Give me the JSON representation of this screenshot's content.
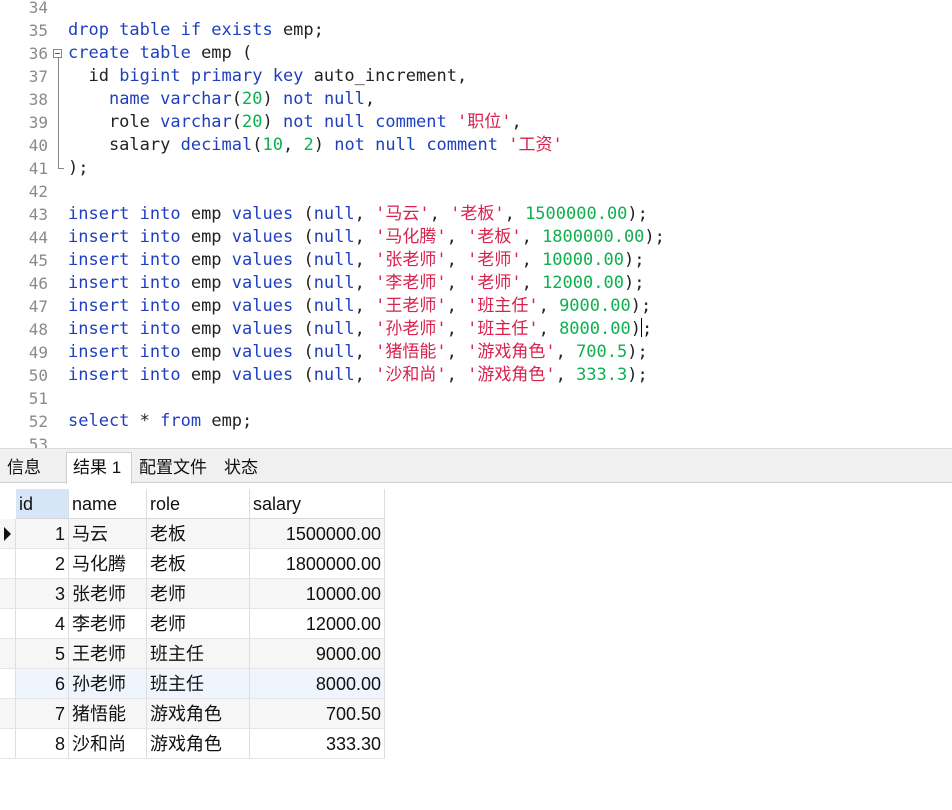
{
  "editor": {
    "first_line_number": 34,
    "lines": [
      [
        {
          "t": "",
          "c": "pl"
        }
      ],
      [
        {
          "t": "drop table if exists",
          "c": "kw"
        },
        {
          "t": " emp;",
          "c": "pl"
        }
      ],
      [
        {
          "t": "create table",
          "c": "kw"
        },
        {
          "t": " emp (",
          "c": "pl"
        }
      ],
      [
        {
          "t": "  id ",
          "c": "pl"
        },
        {
          "t": "bigint primary key",
          "c": "kw"
        },
        {
          "t": " auto_increment,",
          "c": "pl"
        }
      ],
      [
        {
          "t": "    ",
          "c": "pl"
        },
        {
          "t": "name varchar",
          "c": "kw"
        },
        {
          "t": "(",
          "c": "pl"
        },
        {
          "t": "20",
          "c": "num"
        },
        {
          "t": ") ",
          "c": "pl"
        },
        {
          "t": "not null",
          "c": "kw"
        },
        {
          "t": ",",
          "c": "pl"
        }
      ],
      [
        {
          "t": "    role ",
          "c": "pl"
        },
        {
          "t": "varchar",
          "c": "kw"
        },
        {
          "t": "(",
          "c": "pl"
        },
        {
          "t": "20",
          "c": "num"
        },
        {
          "t": ") ",
          "c": "pl"
        },
        {
          "t": "not null comment",
          "c": "kw"
        },
        {
          "t": " ",
          "c": "pl"
        },
        {
          "t": "'职位'",
          "c": "str"
        },
        {
          "t": ",",
          "c": "pl"
        }
      ],
      [
        {
          "t": "    salary ",
          "c": "pl"
        },
        {
          "t": "decimal",
          "c": "kw"
        },
        {
          "t": "(",
          "c": "pl"
        },
        {
          "t": "10",
          "c": "num"
        },
        {
          "t": ", ",
          "c": "pl"
        },
        {
          "t": "2",
          "c": "num"
        },
        {
          "t": ") ",
          "c": "pl"
        },
        {
          "t": "not null comment",
          "c": "kw"
        },
        {
          "t": " ",
          "c": "pl"
        },
        {
          "t": "'工资'",
          "c": "str"
        }
      ],
      [
        {
          "t": ");",
          "c": "pl"
        }
      ],
      [
        {
          "t": "",
          "c": "pl"
        }
      ],
      [
        {
          "t": "insert into",
          "c": "kw"
        },
        {
          "t": " emp ",
          "c": "pl"
        },
        {
          "t": "values",
          "c": "kw"
        },
        {
          "t": " (",
          "c": "pl"
        },
        {
          "t": "null",
          "c": "kw"
        },
        {
          "t": ", ",
          "c": "pl"
        },
        {
          "t": "'马云'",
          "c": "str"
        },
        {
          "t": ", ",
          "c": "pl"
        },
        {
          "t": "'老板'",
          "c": "str"
        },
        {
          "t": ", ",
          "c": "pl"
        },
        {
          "t": "1500000.00",
          "c": "num"
        },
        {
          "t": ");",
          "c": "pl"
        }
      ],
      [
        {
          "t": "insert into",
          "c": "kw"
        },
        {
          "t": " emp ",
          "c": "pl"
        },
        {
          "t": "values",
          "c": "kw"
        },
        {
          "t": " (",
          "c": "pl"
        },
        {
          "t": "null",
          "c": "kw"
        },
        {
          "t": ", ",
          "c": "pl"
        },
        {
          "t": "'马化腾'",
          "c": "str"
        },
        {
          "t": ", ",
          "c": "pl"
        },
        {
          "t": "'老板'",
          "c": "str"
        },
        {
          "t": ", ",
          "c": "pl"
        },
        {
          "t": "1800000.00",
          "c": "num"
        },
        {
          "t": ");",
          "c": "pl"
        }
      ],
      [
        {
          "t": "insert into",
          "c": "kw"
        },
        {
          "t": " emp ",
          "c": "pl"
        },
        {
          "t": "values",
          "c": "kw"
        },
        {
          "t": " (",
          "c": "pl"
        },
        {
          "t": "null",
          "c": "kw"
        },
        {
          "t": ", ",
          "c": "pl"
        },
        {
          "t": "'张老师'",
          "c": "str"
        },
        {
          "t": ", ",
          "c": "pl"
        },
        {
          "t": "'老师'",
          "c": "str"
        },
        {
          "t": ", ",
          "c": "pl"
        },
        {
          "t": "10000.00",
          "c": "num"
        },
        {
          "t": ");",
          "c": "pl"
        }
      ],
      [
        {
          "t": "insert into",
          "c": "kw"
        },
        {
          "t": " emp ",
          "c": "pl"
        },
        {
          "t": "values",
          "c": "kw"
        },
        {
          "t": " (",
          "c": "pl"
        },
        {
          "t": "null",
          "c": "kw"
        },
        {
          "t": ", ",
          "c": "pl"
        },
        {
          "t": "'李老师'",
          "c": "str"
        },
        {
          "t": ", ",
          "c": "pl"
        },
        {
          "t": "'老师'",
          "c": "str"
        },
        {
          "t": ", ",
          "c": "pl"
        },
        {
          "t": "12000.00",
          "c": "num"
        },
        {
          "t": ");",
          "c": "pl"
        }
      ],
      [
        {
          "t": "insert into",
          "c": "kw"
        },
        {
          "t": " emp ",
          "c": "pl"
        },
        {
          "t": "values",
          "c": "kw"
        },
        {
          "t": " (",
          "c": "pl"
        },
        {
          "t": "null",
          "c": "kw"
        },
        {
          "t": ", ",
          "c": "pl"
        },
        {
          "t": "'王老师'",
          "c": "str"
        },
        {
          "t": ", ",
          "c": "pl"
        },
        {
          "t": "'班主任'",
          "c": "str"
        },
        {
          "t": ", ",
          "c": "pl"
        },
        {
          "t": "9000.00",
          "c": "num"
        },
        {
          "t": ");",
          "c": "pl"
        }
      ],
      [
        {
          "t": "insert into",
          "c": "kw"
        },
        {
          "t": " emp ",
          "c": "pl"
        },
        {
          "t": "values",
          "c": "kw"
        },
        {
          "t": " (",
          "c": "pl"
        },
        {
          "t": "null",
          "c": "kw"
        },
        {
          "t": ", ",
          "c": "pl"
        },
        {
          "t": "'孙老师'",
          "c": "str"
        },
        {
          "t": ", ",
          "c": "pl"
        },
        {
          "t": "'班主任'",
          "c": "str"
        },
        {
          "t": ", ",
          "c": "pl"
        },
        {
          "t": "8000.00",
          "c": "num"
        },
        {
          "t": ")",
          "c": "pl"
        },
        {
          "t": "|",
          "c": "caret"
        },
        {
          "t": ";",
          "c": "pl"
        }
      ],
      [
        {
          "t": "insert into",
          "c": "kw"
        },
        {
          "t": " emp ",
          "c": "pl"
        },
        {
          "t": "values",
          "c": "kw"
        },
        {
          "t": " (",
          "c": "pl"
        },
        {
          "t": "null",
          "c": "kw"
        },
        {
          "t": ", ",
          "c": "pl"
        },
        {
          "t": "'猪悟能'",
          "c": "str"
        },
        {
          "t": ", ",
          "c": "pl"
        },
        {
          "t": "'游戏角色'",
          "c": "str"
        },
        {
          "t": ", ",
          "c": "pl"
        },
        {
          "t": "700.5",
          "c": "num"
        },
        {
          "t": ");",
          "c": "pl"
        }
      ],
      [
        {
          "t": "insert into",
          "c": "kw"
        },
        {
          "t": " emp ",
          "c": "pl"
        },
        {
          "t": "values",
          "c": "kw"
        },
        {
          "t": " (",
          "c": "pl"
        },
        {
          "t": "null",
          "c": "kw"
        },
        {
          "t": ", ",
          "c": "pl"
        },
        {
          "t": "'沙和尚'",
          "c": "str"
        },
        {
          "t": ", ",
          "c": "pl"
        },
        {
          "t": "'游戏角色'",
          "c": "str"
        },
        {
          "t": ", ",
          "c": "pl"
        },
        {
          "t": "333.3",
          "c": "num"
        },
        {
          "t": ");",
          "c": "pl"
        }
      ],
      [
        {
          "t": "",
          "c": "pl"
        }
      ],
      [
        {
          "t": "select",
          "c": "kw"
        },
        {
          "t": " * ",
          "c": "pl"
        },
        {
          "t": "from",
          "c": "kw"
        },
        {
          "t": " emp;",
          "c": "pl"
        }
      ],
      [
        {
          "t": "",
          "c": "pl"
        }
      ]
    ]
  },
  "tabs": [
    {
      "label": "信息",
      "active": false
    },
    {
      "label": "结果 1",
      "active": true
    },
    {
      "label": "配置文件",
      "active": false
    },
    {
      "label": "状态",
      "active": false
    }
  ],
  "result_grid": {
    "columns": [
      "id",
      "name",
      "role",
      "salary"
    ],
    "rows": [
      [
        "1",
        "马云",
        "老板",
        "1500000.00"
      ],
      [
        "2",
        "马化腾",
        "老板",
        "1800000.00"
      ],
      [
        "3",
        "张老师",
        "老师",
        "10000.00"
      ],
      [
        "4",
        "李老师",
        "老师",
        "12000.00"
      ],
      [
        "5",
        "王老师",
        "班主任",
        "9000.00"
      ],
      [
        "6",
        "孙老师",
        "班主任",
        "8000.00"
      ],
      [
        "7",
        "猪悟能",
        "游戏角色",
        "700.50"
      ],
      [
        "8",
        "沙和尚",
        "游戏角色",
        "333.30"
      ]
    ],
    "current_row": 0,
    "highlighted_row": 5
  }
}
